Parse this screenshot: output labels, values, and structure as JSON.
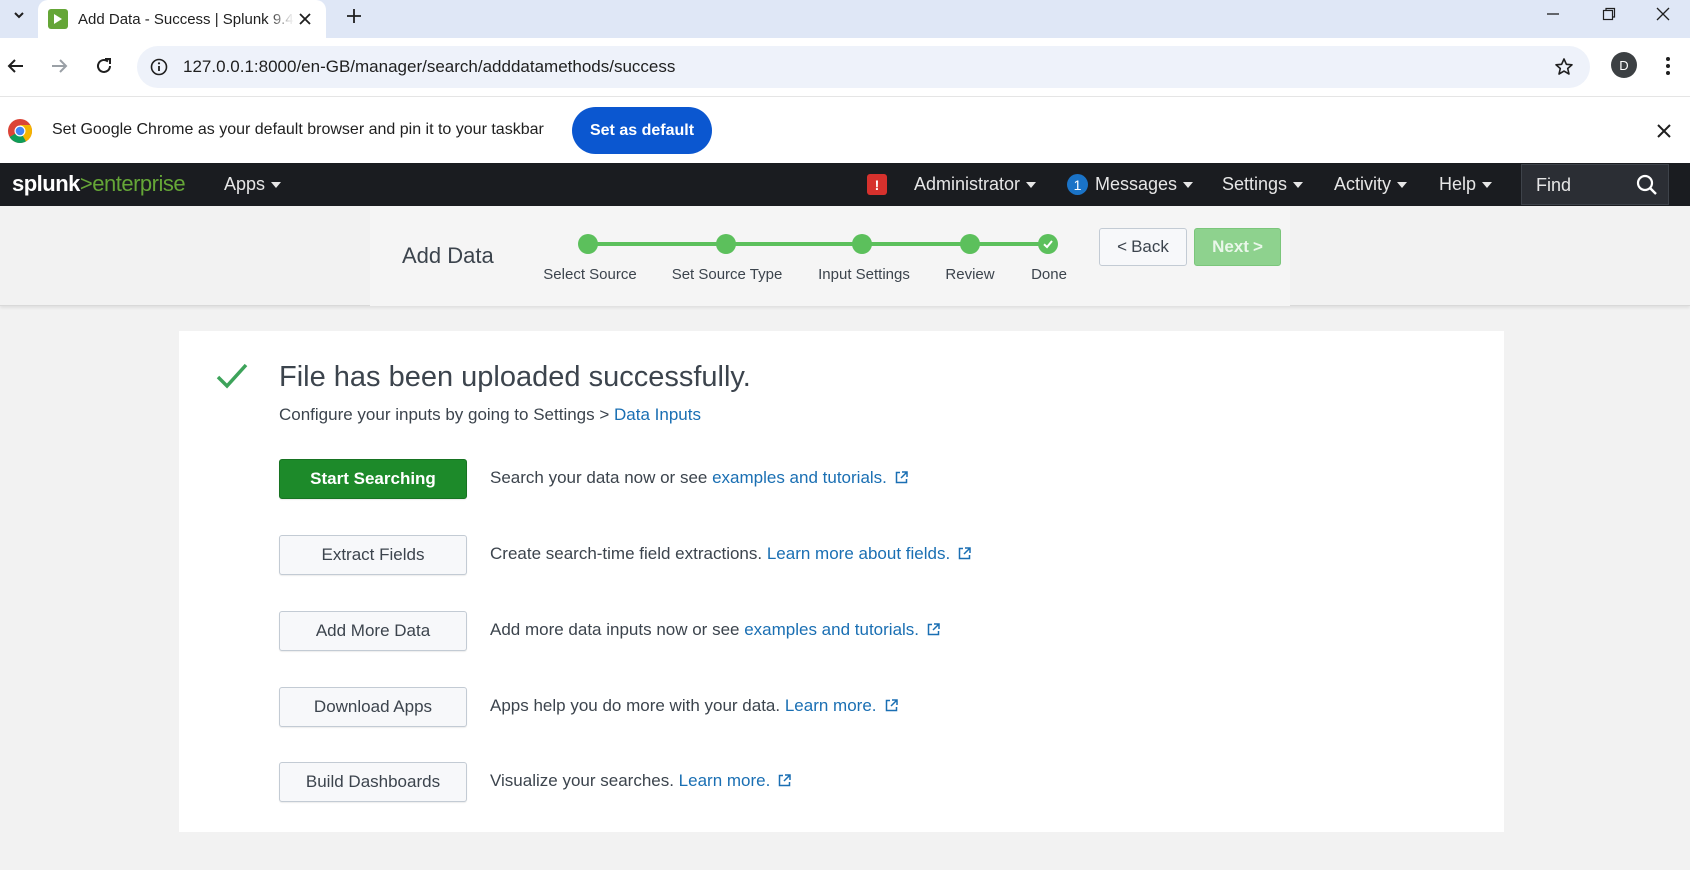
{
  "browser": {
    "tab_title": "Add Data - Success | Splunk 9.4",
    "url": "127.0.0.1:8000/en-GB/manager/search/adddatamethods/success",
    "profile_initial": "D",
    "infobar_text": "Set Google Chrome as your default browser and pin it to your taskbar",
    "infobar_button": "Set as default"
  },
  "splunk_nav": {
    "logo_main": "splunk",
    "logo_gt": ">",
    "logo_product": "enterprise",
    "apps": "Apps",
    "alert_badge": "!",
    "administrator": "Administrator",
    "messages_count": "1",
    "messages": "Messages",
    "settings": "Settings",
    "activity": "Activity",
    "help": "Help",
    "find": "Find"
  },
  "wizard": {
    "title": "Add Data",
    "steps": [
      {
        "label": "Select Source",
        "state": "complete"
      },
      {
        "label": "Set Source Type",
        "state": "complete"
      },
      {
        "label": "Input Settings",
        "state": "complete"
      },
      {
        "label": "Review",
        "state": "complete"
      },
      {
        "label": "Done",
        "state": "current-complete"
      }
    ],
    "back": "Back",
    "next": "Next",
    "back_chevron": "<",
    "next_chevron": ">"
  },
  "success": {
    "headline": "File has been uploaded successfully.",
    "sub_prefix": "Configure your inputs by going to Settings > ",
    "sub_link": "Data Inputs",
    "actions": [
      {
        "button": "Start Searching",
        "primary": true,
        "desc": "Search your data now or see ",
        "link": "examples and tutorials."
      },
      {
        "button": "Extract Fields",
        "primary": false,
        "desc": "Create search-time field extractions. ",
        "link": "Learn more about fields."
      },
      {
        "button": "Add More Data",
        "primary": false,
        "desc": "Add more data inputs now or see ",
        "link": "examples and tutorials."
      },
      {
        "button": "Download Apps",
        "primary": false,
        "desc": "Apps help you do more with your data. ",
        "link": "Learn more."
      },
      {
        "button": "Build Dashboards",
        "primary": false,
        "desc": "Visualize your searches. ",
        "link": "Learn more."
      }
    ]
  },
  "colors": {
    "splunk_green": "#65a637",
    "step_green": "#5cc05c",
    "primary_button": "#1d8a2a",
    "link_blue": "#1a6fb3",
    "chrome_blue": "#0b57d0",
    "nav_bg": "#1a1c20"
  }
}
